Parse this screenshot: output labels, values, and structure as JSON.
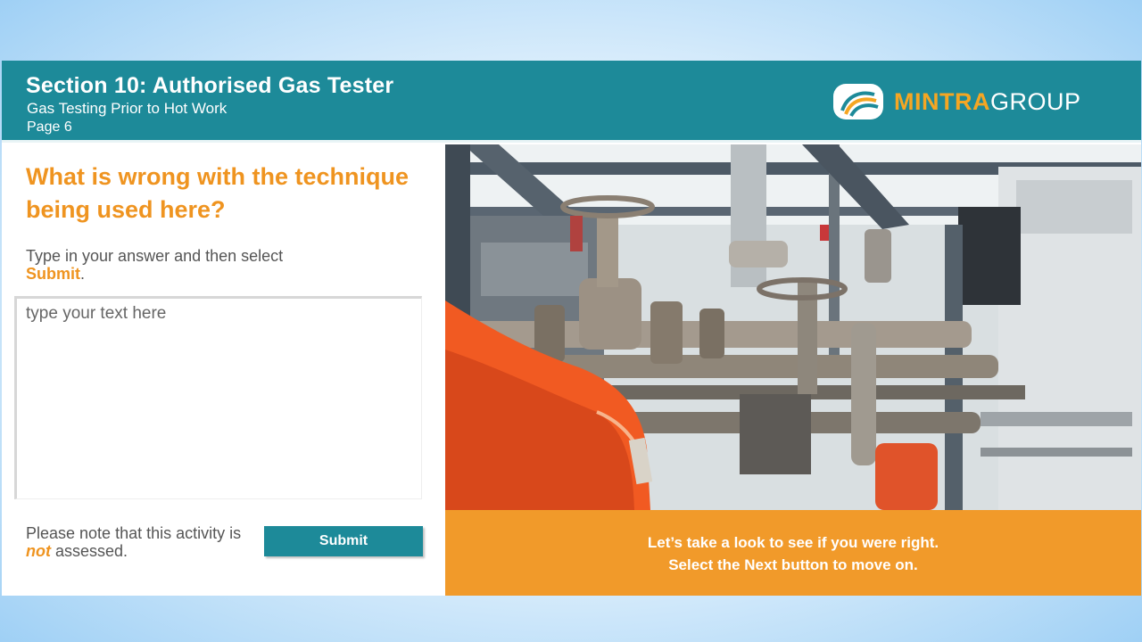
{
  "header": {
    "title": "Section 10: Authorised Gas Tester",
    "subtitle": "Gas Testing Prior to Hot Work",
    "page": "Page 6",
    "logo": {
      "part1": "MINTRA",
      "part2": "GROUP",
      "accent_color": "#f5a623"
    }
  },
  "activity": {
    "question": "What is wrong with the technique being used here?",
    "instruction_prefix": "Type in your answer and then select",
    "instruction_highlight": "Submit",
    "instruction_suffix": ".",
    "answer_placeholder": "type your text here",
    "note_prefix": "Please note that this activity is",
    "note_highlight": "not",
    "note_suffix": "assessed.",
    "submit_label": "Submit"
  },
  "feedback": {
    "line1": "Let’s take a look to see if you were right.",
    "line2": "Select the Next button to move on."
  },
  "colors": {
    "header_bg": "#1d8a99",
    "accent_orange": "#ef9420",
    "caption_bg": "#f19a2a"
  }
}
